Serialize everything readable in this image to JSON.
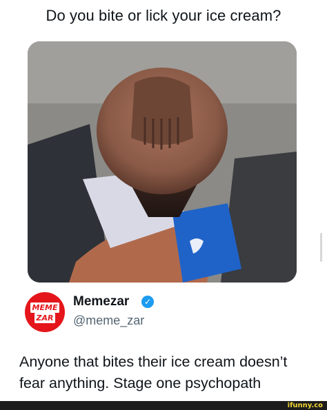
{
  "post": {
    "question": "Do you bite or lick your ice cream?",
    "image_icon": "ice-cream-photo"
  },
  "profile": {
    "avatar_line1": "MEME",
    "avatar_line2": "ZAR",
    "name": "Memezar",
    "verified_icon": "verified-badge-icon",
    "handle": "@meme_zar"
  },
  "tweet": {
    "text": "Anyone that bites their ice cream doesn’t fear anything. Stage one psychopath"
  },
  "footer": {
    "watermark": "ifunny.co"
  },
  "colors": {
    "avatar_red": "#e4161b",
    "verified_blue": "#1d9bf0",
    "handle_gray": "#536471",
    "watermark_yellow": "#f2d534"
  }
}
